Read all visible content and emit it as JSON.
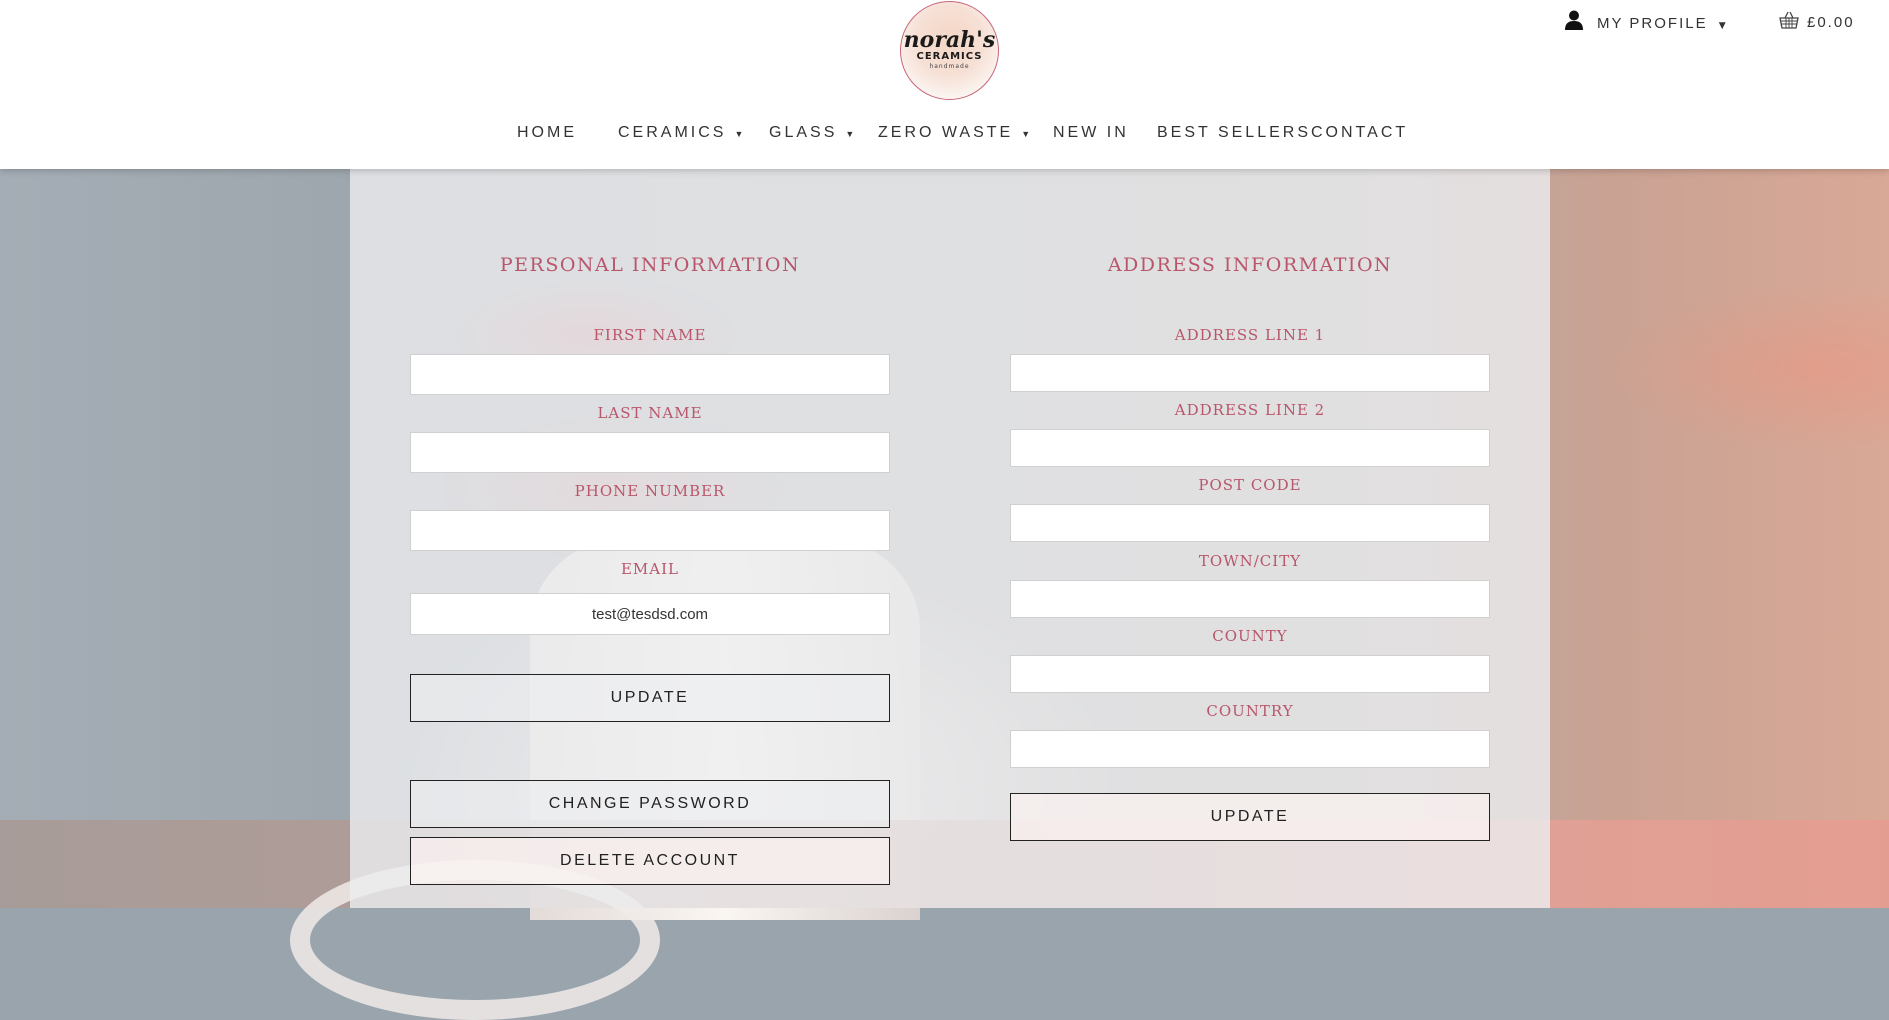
{
  "header": {
    "logo": {
      "main": "norah's",
      "sub": "CERAMICS",
      "tag": "handmade"
    },
    "profile_label": "MY PROFILE",
    "cart_total": "£0.00",
    "icons": {
      "profile": "user-icon",
      "cart": "basket-icon",
      "dropdown": "caret-down-icon"
    }
  },
  "nav": {
    "items": [
      {
        "label": "HOME",
        "dropdown": false
      },
      {
        "label": "CERAMICS",
        "dropdown": true
      },
      {
        "label": "GLASS",
        "dropdown": true
      },
      {
        "label": "ZERO WASTE",
        "dropdown": true
      },
      {
        "label": "NEW IN",
        "dropdown": false
      },
      {
        "label": "BEST SELLERS",
        "dropdown": false
      },
      {
        "label": "CONTACT",
        "dropdown": false
      }
    ]
  },
  "personal": {
    "title": "PERSONAL INFORMATION",
    "fields": [
      {
        "label": "FIRST NAME",
        "value": ""
      },
      {
        "label": "LAST NAME",
        "value": ""
      },
      {
        "label": "PHONE NUMBER",
        "value": ""
      },
      {
        "label": "EMAIL",
        "value": "test@tesdsd.com"
      }
    ],
    "update_button": "UPDATE",
    "change_password_button": "CHANGE PASSWORD",
    "delete_account_button": "DELETE ACCOUNT"
  },
  "address": {
    "title": "ADDRESS INFORMATION",
    "fields": [
      {
        "label": "ADDRESS LINE 1",
        "value": ""
      },
      {
        "label": "ADDRESS LINE 2",
        "value": ""
      },
      {
        "label": "POST CODE",
        "value": ""
      },
      {
        "label": "TOWN/CITY",
        "value": ""
      },
      {
        "label": "COUNTY",
        "value": ""
      },
      {
        "label": "COUNTRY",
        "value": ""
      }
    ],
    "update_button": "UPDATE"
  },
  "colors": {
    "accent": "#b8566b",
    "header_bg": "#ffffff",
    "text": "#222222"
  }
}
